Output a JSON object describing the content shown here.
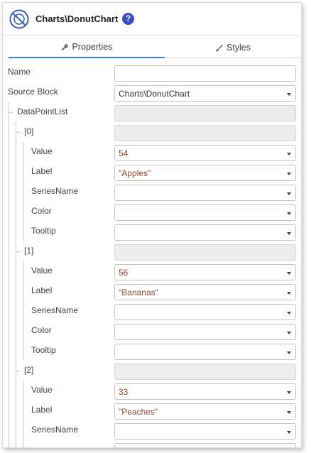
{
  "header": {
    "title": "Charts\\DonutChart",
    "help_label": "?"
  },
  "tabs": [
    {
      "label": "Properties",
      "icon": "wrench-icon",
      "active": true
    },
    {
      "label": "Styles",
      "icon": "brush-icon",
      "active": false
    }
  ],
  "colors": {
    "accent": "#3a7bd5",
    "help_badge": "#3b4fc4",
    "value_text": "#8b4a32"
  },
  "properties": {
    "name": {
      "label": "Name",
      "value": ""
    },
    "source_block": {
      "label": "Source Block",
      "value": "Charts\\DonutChart"
    },
    "data_point_list": {
      "label": "DataPointList"
    },
    "points": [
      {
        "index_label": "[0]",
        "value_label": "Value",
        "value": "54",
        "label_label": "Label",
        "label": "\"Apples\"",
        "series_label": "SeriesName",
        "series": "",
        "color_label": "Color",
        "color": "",
        "tooltip_label": "Tooltip",
        "tooltip": ""
      },
      {
        "index_label": "[1]",
        "value_label": "Value",
        "value": "56",
        "label_label": "Label",
        "label": "\"Bananas\"",
        "series_label": "SeriesName",
        "series": "",
        "color_label": "Color",
        "color": "",
        "tooltip_label": "Tooltip",
        "tooltip": ""
      },
      {
        "index_label": "[2]",
        "value_label": "Value",
        "value": "33",
        "label_label": "Label",
        "label": "\"Peaches\"",
        "series_label": "SeriesName",
        "series": ""
      }
    ]
  }
}
